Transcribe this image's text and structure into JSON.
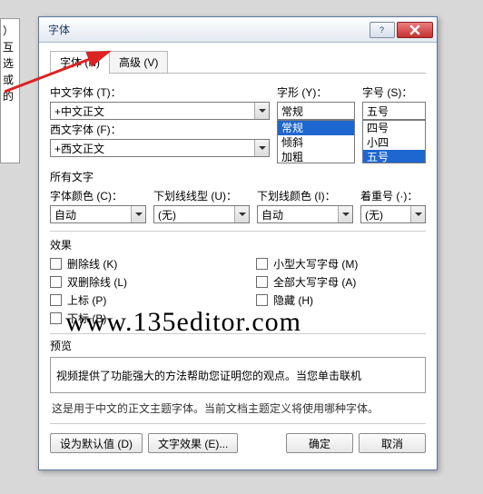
{
  "window": {
    "title": "字体"
  },
  "tabs": [
    {
      "label": "字体 (N)"
    },
    {
      "label": "高级 (V)"
    }
  ],
  "font": {
    "zh_label": "中文字体 (T)：",
    "zh_value": "+中文正文",
    "wf_label": "西文字体 (F)：",
    "wf_value": "+西文正文",
    "style_label": "字形 (Y)：",
    "style_value": "常规",
    "style_options": [
      "常规",
      "倾斜",
      "加粗"
    ],
    "size_label": "字号 (S)：",
    "size_value": "五号",
    "size_options": [
      "四号",
      "小四",
      "五号"
    ]
  },
  "allchars": {
    "heading": "所有文字",
    "color_label": "字体颜色 (C)：",
    "color_value": "自动",
    "ul_label": "下划线线型 (U)：",
    "ul_value": "(无)",
    "ulcolor_label": "下划线颜色 (I)：",
    "ulcolor_value": "自动",
    "em_label": "着重号 (·)：",
    "em_value": "(无)"
  },
  "effects": {
    "heading": "效果",
    "items": [
      "删除线 (K)",
      "双删除线 (L)",
      "上标 (P)",
      "下标 (B)",
      "小型大写字母 (M)",
      "全部大写字母 (A)",
      "隐藏 (H)"
    ]
  },
  "preview": {
    "heading": "预览",
    "text": "视频提供了功能强大的方法帮助您证明您的观点。当您单击联机",
    "desc": "这是用于中文的正文主题字体。当前文档主题定义将使用哪种字体。"
  },
  "buttons": {
    "default": "设为默认值 (D)",
    "textfx": "文字效果 (E)...",
    "ok": "确定",
    "cancel": "取消"
  },
  "watermark": "www.135editor.com",
  "leftbar": "）互选    或 的"
}
